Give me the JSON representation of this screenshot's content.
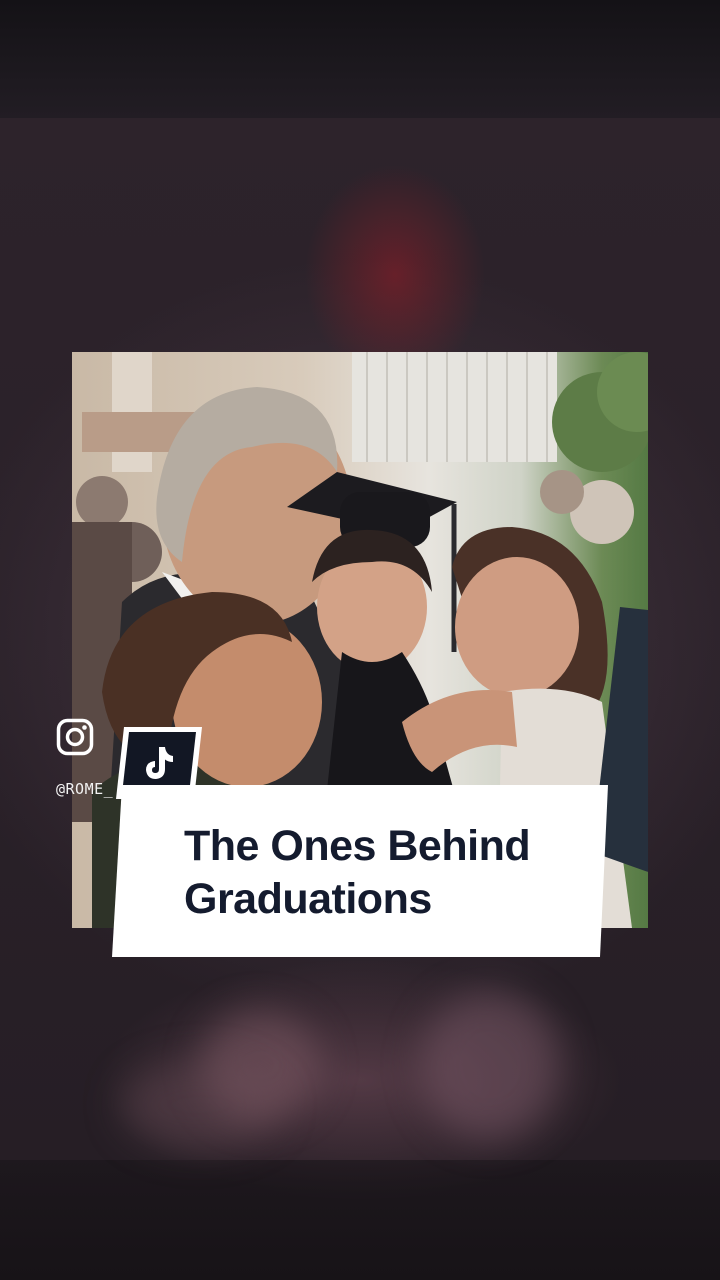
{
  "caption": {
    "line1": "The Ones Behind",
    "line2": "Graduations"
  },
  "social": {
    "handle": "@ROME_",
    "icons": [
      "instagram-icon",
      "tiktok-icon"
    ]
  },
  "colors": {
    "caption_text": "#141b2e",
    "caption_bg": "#ffffff",
    "tiktok_badge": "#121724",
    "background": "#2a2129"
  }
}
